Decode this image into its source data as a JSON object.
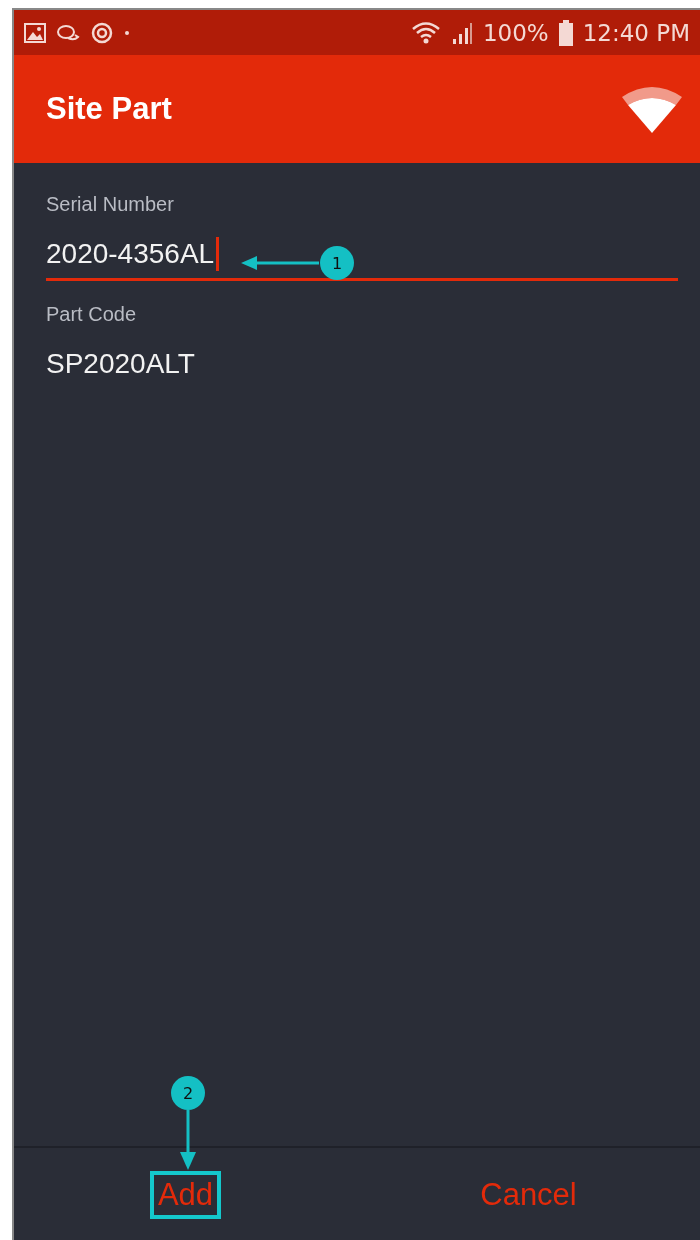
{
  "status_bar": {
    "battery": "100%",
    "time": "12:40 PM"
  },
  "app_bar": {
    "title": "Site Part"
  },
  "fields": [
    {
      "label": "Serial Number",
      "value": "2020-4356AL",
      "focused": true
    },
    {
      "label": "Part Code",
      "value": "SP2020ALT",
      "focused": false
    }
  ],
  "buttons": [
    {
      "label": "Add",
      "highlighted": true
    },
    {
      "label": "Cancel",
      "highlighted": false
    }
  ],
  "callouts": [
    {
      "number": "1"
    },
    {
      "number": "2"
    }
  ]
}
